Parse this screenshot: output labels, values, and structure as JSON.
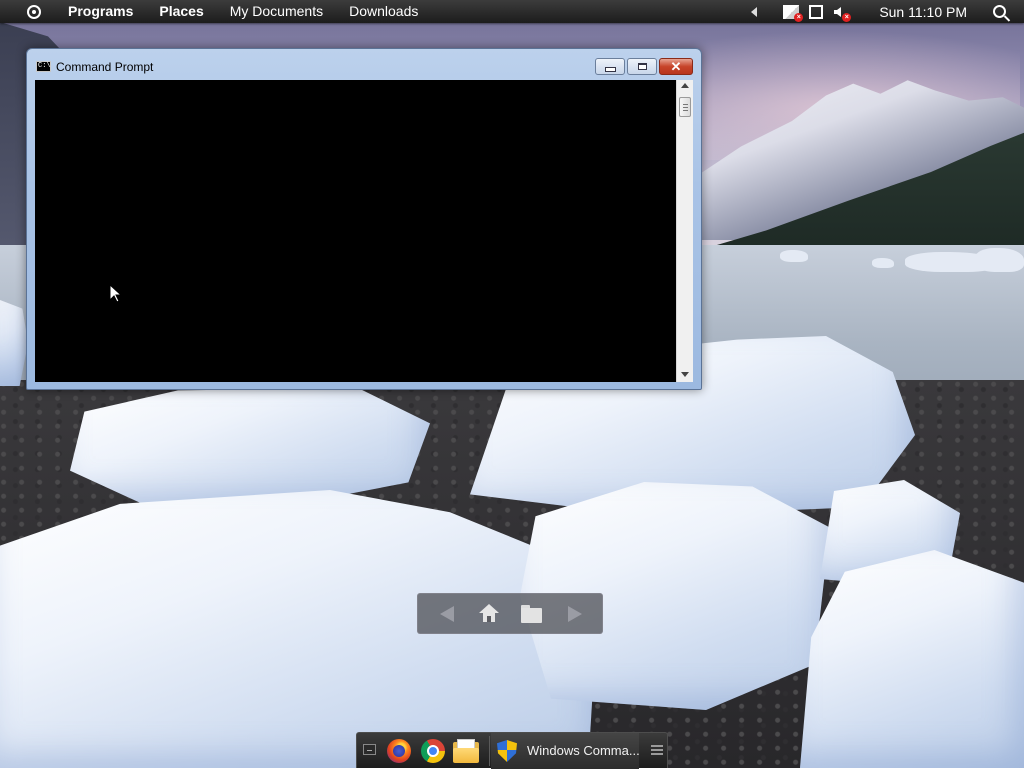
{
  "top_panel": {
    "menu_icon": "circle-dot-icon",
    "links": [
      "Programs",
      "Places",
      "My Documents",
      "Downloads"
    ],
    "clock": "Sun 11:10 PM",
    "tray_icons": [
      "expand-arrow-icon",
      "flag-alert-icon",
      "network-disconnected-icon",
      "volume-muted-icon",
      "search-icon"
    ]
  },
  "window": {
    "title": "Command Prompt",
    "icon": "cmd-icon",
    "icon_text": "C:\\",
    "buttons": [
      "minimize",
      "maximize",
      "close"
    ],
    "close_glyph": "✕"
  },
  "navigator": {
    "buttons": [
      "back-arrow-icon",
      "home-icon",
      "folder-icon",
      "forward-arrow-icon"
    ]
  },
  "dock": {
    "apps": [
      "show-desktop-icon",
      "firefox-icon",
      "chrome-icon",
      "files-icon"
    ],
    "task_label": "Windows Comma...",
    "menu_icon": "hamburger-icon"
  },
  "colors": {
    "console_bg": "#000000",
    "panel_bg": "#1c1c1c",
    "window_frame": "#a9c3e6",
    "close_button": "#c7442a"
  }
}
